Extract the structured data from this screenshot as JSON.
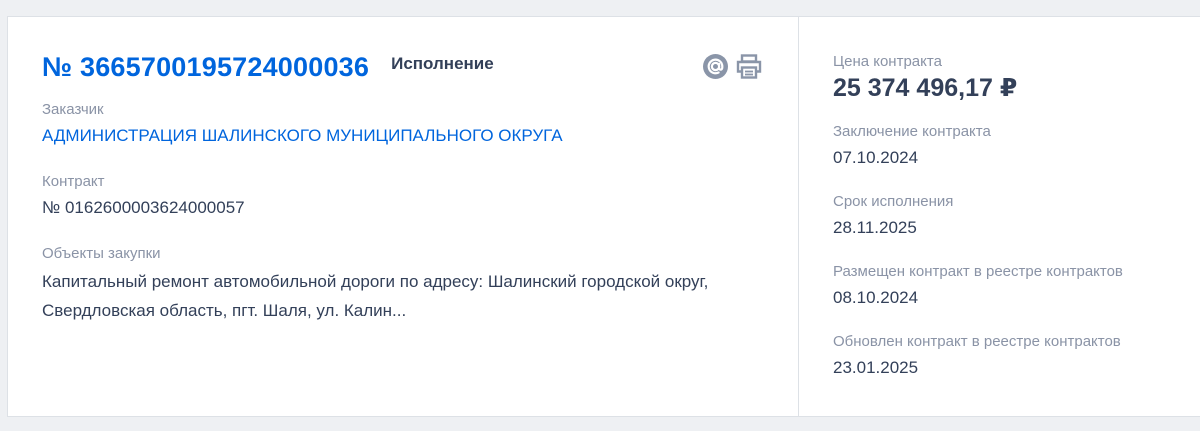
{
  "card": {
    "reg_number": "№ 3665700195724000036",
    "status": "Исполнение",
    "icons": {
      "email": "at-sign-icon",
      "print": "printer-icon"
    },
    "customer": {
      "label": "Заказчик",
      "value": "АДМИНИСТРАЦИЯ ШАЛИНСКОГО МУНИЦИПАЛЬНОГО ОКРУГА"
    },
    "contract": {
      "label": "Контракт",
      "value": "№ 0162600003624000057"
    },
    "objects": {
      "label": "Объекты закупки",
      "value": "Капитальный ремонт автомобильной дороги по адресу: Шалинский городской округ, Свердловская область, пгт. Шаля, ул. Калин..."
    }
  },
  "details": {
    "price": {
      "label": "Цена контракта",
      "value": "25 374 496,17 ₽"
    },
    "conclusion": {
      "label": "Заключение контракта",
      "value": "07.10.2024"
    },
    "execution": {
      "label": "Срок исполнения",
      "value": "28.11.2025"
    },
    "placed": {
      "label": "Размещен контракт в реестре контрактов",
      "value": "08.10.2024"
    },
    "updated": {
      "label": "Обновлен контракт в реестре контрактов",
      "value": "23.01.2025"
    }
  },
  "colors": {
    "link": "#0065dd",
    "text": "#334059",
    "label": "#8a93a6",
    "icon": "#8a95a8",
    "border": "#dde1e6",
    "background": "#eef0f3"
  }
}
